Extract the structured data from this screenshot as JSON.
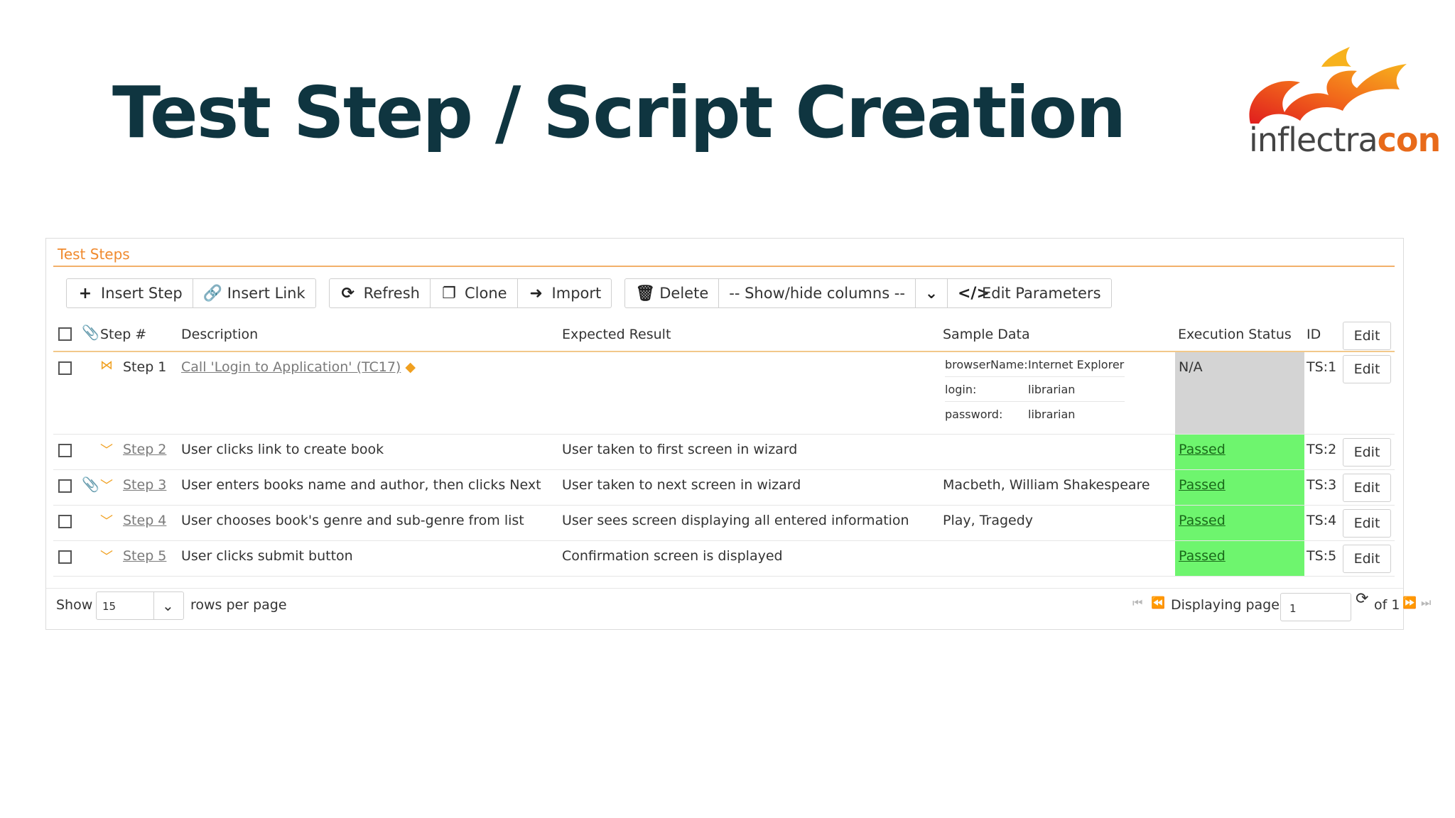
{
  "slide": {
    "title": "Test Step / Script Creation",
    "logo_part1": "inflectra",
    "logo_part2": "con"
  },
  "panel": {
    "title": "Test Steps",
    "toolbar": {
      "insert_step": "Insert Step",
      "insert_link": "Insert Link",
      "refresh": "Refresh",
      "clone": "Clone",
      "import": "Import",
      "delete": "Delete",
      "show_hide": "-- Show/hide columns --",
      "edit_parameters": "Edit Parameters"
    },
    "columns": {
      "step": "Step #",
      "description": "Description",
      "expected": "Expected Result",
      "sample": "Sample Data",
      "status": "Execution Status",
      "id": "ID",
      "edit": "Edit"
    },
    "rows": [
      {
        "step": "Step 1",
        "description": "Call 'Login to Application' (TC17)",
        "expected": "",
        "sample_params": [
          {
            "key": "browserName:",
            "value": "Internet Explorer"
          },
          {
            "key": "login:",
            "value": "librarian"
          },
          {
            "key": "password:",
            "value": "librarian"
          }
        ],
        "status": "N/A",
        "id": "TS:1",
        "edit": "Edit"
      },
      {
        "step": "Step 2",
        "description": "User clicks link to create book",
        "expected": "User taken to first screen in wizard",
        "sample": "",
        "status": "Passed",
        "id": "TS:2",
        "edit": "Edit"
      },
      {
        "step": "Step 3",
        "description": "User enters books name and author, then clicks Next",
        "expected": "User taken to next screen in wizard",
        "sample": "Macbeth, William Shakespeare",
        "status": "Passed",
        "id": "TS:3",
        "edit": "Edit"
      },
      {
        "step": "Step 4",
        "description": "User chooses book's genre and sub-genre from list",
        "expected": "User sees screen displaying all entered information",
        "sample": "Play, Tragedy",
        "status": "Passed",
        "id": "TS:4",
        "edit": "Edit"
      },
      {
        "step": "Step 5",
        "description": "User clicks submit button",
        "expected": "Confirmation screen is displayed",
        "sample": "",
        "status": "Passed",
        "id": "TS:5",
        "edit": "Edit"
      }
    ],
    "footer": {
      "show": "Show",
      "rows_per_page_value": "15",
      "rows_per_page": "rows per page",
      "displaying_page": "Displaying page",
      "page": "1",
      "of": "of 1"
    }
  },
  "colors": {
    "title": "#0f3540",
    "accent_orange": "#f08a2e",
    "passed_bg": "#6ef56e",
    "na_bg": "#d4d4d4"
  }
}
